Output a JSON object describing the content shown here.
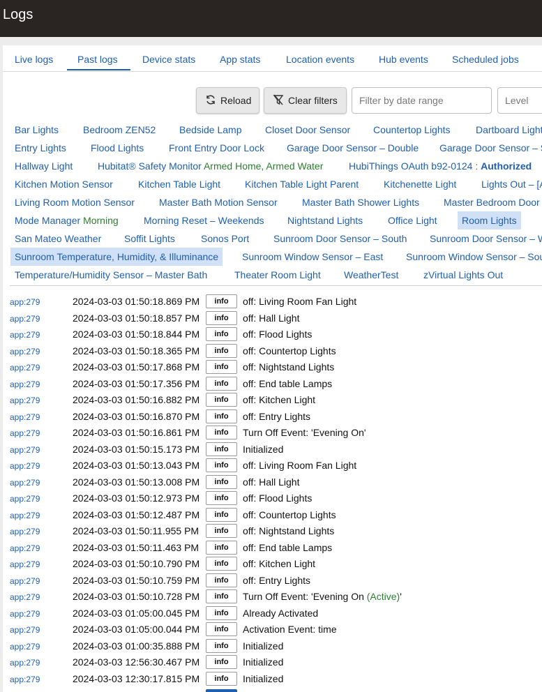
{
  "app": {
    "title": "Logs"
  },
  "tabs": [
    {
      "label": "Live logs"
    },
    {
      "label": "Past logs",
      "active": true
    },
    {
      "label": "Device stats"
    },
    {
      "label": "App stats"
    },
    {
      "label": "Location events"
    },
    {
      "label": "Hub events"
    },
    {
      "label": "Scheduled jobs"
    }
  ],
  "toolbar": {
    "reload_label": "Reload",
    "clear_filters_label": "Clear filters",
    "date_range_placeholder": "Filter by date range",
    "level_value": "Level"
  },
  "filters": [
    {
      "label": "Bar Lights"
    },
    {
      "label": "Bedroom ZEN52"
    },
    {
      "label": "Bedside Lamp"
    },
    {
      "label": "Closet Door Sensor"
    },
    {
      "label": "Countertop Lights"
    },
    {
      "label": "Dartboard Light"
    },
    {
      "label": "Entry Lights"
    },
    {
      "label": "Flood Lights"
    },
    {
      "label": "Front Entry Door Lock"
    },
    {
      "label": "Garage Door Sensor – Double"
    },
    {
      "label": "Garage Door Sensor – S"
    },
    {
      "label": "Hallway Light"
    },
    {
      "label": "Hubitat® Safety Monitor",
      "status": "Armed Home, Armed Water"
    },
    {
      "label": "HubiThings OAuth b92-0124 :",
      "status": "Authorized"
    },
    {
      "label": "Kitchen Motion Sensor"
    },
    {
      "label": "Kitchen Table Light"
    },
    {
      "label": "Kitchen Table Light Parent"
    },
    {
      "label": "Kitchenette Light"
    },
    {
      "label": "Lights Out – [A"
    },
    {
      "label": "Living Room Motion Sensor"
    },
    {
      "label": "Master Bath Motion Sensor"
    },
    {
      "label": "Master Bath Shower Lights"
    },
    {
      "label": "Master Bedroom Door"
    },
    {
      "label": "Mode Manager",
      "status": "Morning"
    },
    {
      "label": "Morning Reset – Weekends"
    },
    {
      "label": "Nightstand Lights"
    },
    {
      "label": "Office Light"
    },
    {
      "label": "Room Lights",
      "selected": true
    },
    {
      "label": "San Mateo Weather"
    },
    {
      "label": "Soffit Lights"
    },
    {
      "label": "Sonos Port"
    },
    {
      "label": "Sunroom Door Sensor – South"
    },
    {
      "label": "Sunroom Door Sensor – W"
    },
    {
      "label": "Sunroom Temperature, Humidity, & Illuminance",
      "selected": true
    },
    {
      "label": "Sunroom Window Sensor – East"
    },
    {
      "label": "Sunroom Window Sensor – Sou"
    },
    {
      "label": "Temperature/Humidity Sensor – Master Bath"
    },
    {
      "label": "Theater Room Light"
    },
    {
      "label": "WeatherTest"
    },
    {
      "label": "zVirtual Lights Out"
    }
  ],
  "logs": [
    {
      "source": "app:279",
      "time": "2024-03-03 01:50:18.869 PM",
      "level": "info",
      "message": "off: Living Room Fan Light"
    },
    {
      "source": "app:279",
      "time": "2024-03-03 01:50:18.857 PM",
      "level": "info",
      "message": "off: Hall Light"
    },
    {
      "source": "app:279",
      "time": "2024-03-03 01:50:18.844 PM",
      "level": "info",
      "message": "off: Flood Lights"
    },
    {
      "source": "app:279",
      "time": "2024-03-03 01:50:18.365 PM",
      "level": "info",
      "message": "off: Countertop Lights"
    },
    {
      "source": "app:279",
      "time": "2024-03-03 01:50:17.868 PM",
      "level": "info",
      "message": "off: Nightstand Lights"
    },
    {
      "source": "app:279",
      "time": "2024-03-03 01:50:17.356 PM",
      "level": "info",
      "message": "off: End table Lamps"
    },
    {
      "source": "app:279",
      "time": "2024-03-03 01:50:16.882 PM",
      "level": "info",
      "message": "off: Kitchen Light"
    },
    {
      "source": "app:279",
      "time": "2024-03-03 01:50:16.870 PM",
      "level": "info",
      "message": "off: Entry Lights"
    },
    {
      "source": "app:279",
      "time": "2024-03-03 01:50:16.861 PM",
      "level": "info",
      "message": "Turn Off Event: 'Evening On'"
    },
    {
      "source": "app:279",
      "time": "2024-03-03 01:50:15.173 PM",
      "level": "info",
      "message": "Initialized"
    },
    {
      "source": "app:279",
      "time": "2024-03-03 01:50:13.043 PM",
      "level": "info",
      "message": "off: Living Room Fan Light"
    },
    {
      "source": "app:279",
      "time": "2024-03-03 01:50:13.008 PM",
      "level": "info",
      "message": "off: Hall Light"
    },
    {
      "source": "app:279",
      "time": "2024-03-03 01:50:12.973 PM",
      "level": "info",
      "message": "off: Flood Lights"
    },
    {
      "source": "app:279",
      "time": "2024-03-03 01:50:12.487 PM",
      "level": "info",
      "message": "off: Countertop Lights"
    },
    {
      "source": "app:279",
      "time": "2024-03-03 01:50:11.955 PM",
      "level": "info",
      "message": "off: Nightstand Lights"
    },
    {
      "source": "app:279",
      "time": "2024-03-03 01:50:11.463 PM",
      "level": "info",
      "message": "off: End table Lamps"
    },
    {
      "source": "app:279",
      "time": "2024-03-03 01:50:10.790 PM",
      "level": "info",
      "message": "off: Kitchen Light"
    },
    {
      "source": "app:279",
      "time": "2024-03-03 01:50:10.759 PM",
      "level": "info",
      "message": "off: Entry Lights"
    },
    {
      "source": "app:279",
      "time": "2024-03-03 01:50:10.728 PM",
      "level": "info",
      "message": "Turn Off Event: 'Evening On ",
      "status": "(Active)",
      "suffix": "'"
    },
    {
      "source": "app:279",
      "time": "2024-03-03 01:05:00.045 PM",
      "level": "info",
      "message": "Already Activated"
    },
    {
      "source": "app:279",
      "time": "2024-03-03 01:05:00.044 PM",
      "level": "info",
      "message": "Activation Event: time"
    },
    {
      "source": "app:279",
      "time": "2024-03-03 01:00:35.888 PM",
      "level": "info",
      "message": "Initialized"
    },
    {
      "source": "app:279",
      "time": "2024-03-03 12:56:30.467 PM",
      "level": "info",
      "message": "Initialized"
    },
    {
      "source": "app:279",
      "time": "2024-03-03 12:30:17.815 PM",
      "level": "info",
      "message": "Initialized"
    }
  ],
  "colors": {
    "topbar": "#2a2523",
    "link": "#1f5fb0",
    "status_green": "#2e7d32",
    "selected_bg": "#cfe0f7"
  }
}
